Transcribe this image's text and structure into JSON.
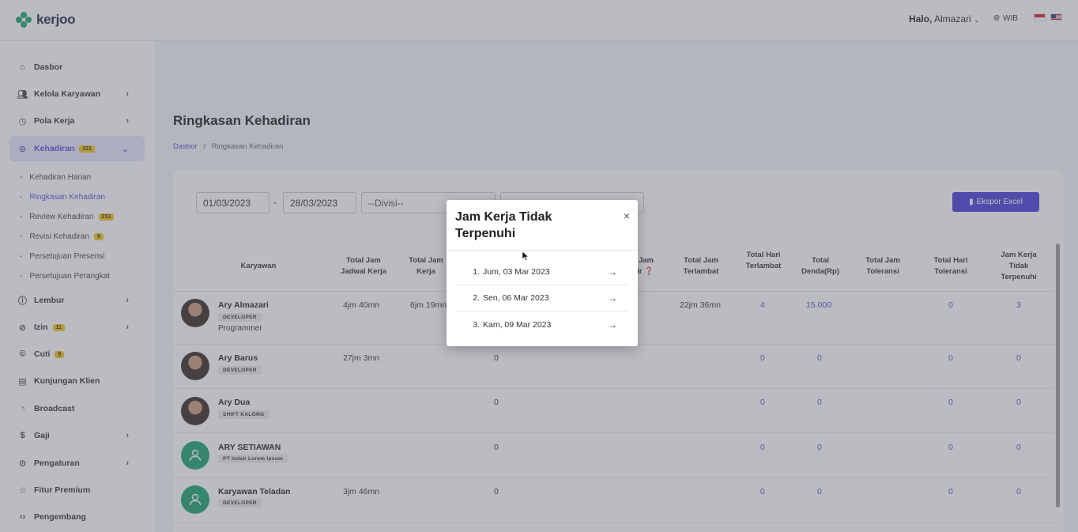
{
  "topbar": {
    "brand": "kerjoo",
    "greeting_prefix": "Halo,",
    "user_name": "Almazari",
    "timezone": "WIB"
  },
  "sidebar": {
    "items": [
      {
        "label": "Dasbor",
        "icon": "home-icon"
      },
      {
        "label": "Kelola Karyawan",
        "icon": "users-icon"
      },
      {
        "label": "Pola Kerja",
        "icon": "clock-icon"
      },
      {
        "label": "Kehadiran",
        "icon": "location-pin-icon",
        "badge": "221"
      },
      {
        "label": "Lembur",
        "icon": "info-icon"
      },
      {
        "label": "Izin",
        "icon": "block-icon",
        "badge": "11"
      },
      {
        "label": "Cuti",
        "icon": "copyright-icon",
        "badge": "9"
      },
      {
        "label": "Kunjungan Klien",
        "icon": "briefcase-icon"
      },
      {
        "label": "Broadcast",
        "icon": "broadcast-icon"
      },
      {
        "label": "Gaji",
        "icon": "dollar-icon"
      },
      {
        "label": "Pengaturan",
        "icon": "gear-icon"
      },
      {
        "label": "Fitur Premium",
        "icon": "star-icon"
      },
      {
        "label": "Pengembang",
        "icon": "code-icon"
      }
    ],
    "sub_items": [
      {
        "label": "Kehadiran Harian"
      },
      {
        "label": "Ringkasan Kehadiran"
      },
      {
        "label": "Review Kehadiran",
        "badge": "213"
      },
      {
        "label": "Revisi Kehadiran",
        "badge": "9"
      },
      {
        "label": "Persetujuan Presensi"
      },
      {
        "label": "Persetujuan Perangkat"
      }
    ]
  },
  "main": {
    "title": "Ringkasan Kehadiran",
    "breadcrumb": {
      "home": "Dasbor",
      "sep": "/",
      "current": "Ringkasan Kehadiran"
    },
    "filters": {
      "start_date": "01/03/2023",
      "date_sep": "-",
      "end_date": "28/03/2023",
      "division": "--Divisi--"
    },
    "export_label": "Ekspor Excel"
  },
  "table": {
    "headers": {
      "employee": "Karyawan",
      "schedule": "Total Jam\nJadwal Kerja",
      "work": "Total Jam\nKerja",
      "late_hours": "Total Jam\nTerlambat",
      "late_days": "Total Hari\nTerlambat",
      "fine": "Total\nDenda(Rp)",
      "tol_hours": "Total Jam\nToleransi",
      "tol_days": "Total Hari\nToleransi",
      "unmet": "Jam Kerja\nTidak\nTerpenuhi"
    },
    "rows": [
      {
        "name": "Ary Almazari",
        "tag": "DEVELOPER",
        "role": "Programmer",
        "schedule": "4jm 40mn",
        "work": "6jm 19mn",
        "late_hours": "22jm 36mn",
        "late_days": "4",
        "fine": "15.000",
        "tol_days": "0",
        "unmet": "3"
      },
      {
        "name": "Ary Barus",
        "tag": "DEVELOPER",
        "schedule": "27jm 3mn",
        "mid": "0",
        "late_days": "0",
        "fine": "0",
        "tol_days": "0",
        "unmet": "0"
      },
      {
        "name": "Ary Dua",
        "tag": "SHIFT KALONG",
        "mid": "0",
        "late_days": "0",
        "fine": "0",
        "tol_days": "0",
        "unmet": "0"
      },
      {
        "name": "ARY SETIAWAN",
        "tag": "PT Indah Lorem Ipsum",
        "mid": "0",
        "late_days": "0",
        "fine": "0",
        "tol_days": "0",
        "unmet": "0"
      },
      {
        "name": "Karyawan Teladan",
        "tag": "DEVELOPER",
        "schedule": "3jm 46mn",
        "mid": "0",
        "late_days": "0",
        "fine": "0",
        "tol_days": "0",
        "unmet": "0"
      }
    ]
  },
  "modal": {
    "title": "Jam Kerja Tidak Terpenuhi",
    "close": "×",
    "items": [
      {
        "num": "1.",
        "label": "Jum, 03 Mar 2023"
      },
      {
        "num": "2.",
        "label": "Sen, 06 Mar 2023"
      },
      {
        "num": "3.",
        "label": "Kam, 09 Mar 2023"
      }
    ]
  },
  "colors": {
    "accent": "#4b3fd8",
    "brand_green": "#1fa36a",
    "badge": "#f5c518"
  }
}
